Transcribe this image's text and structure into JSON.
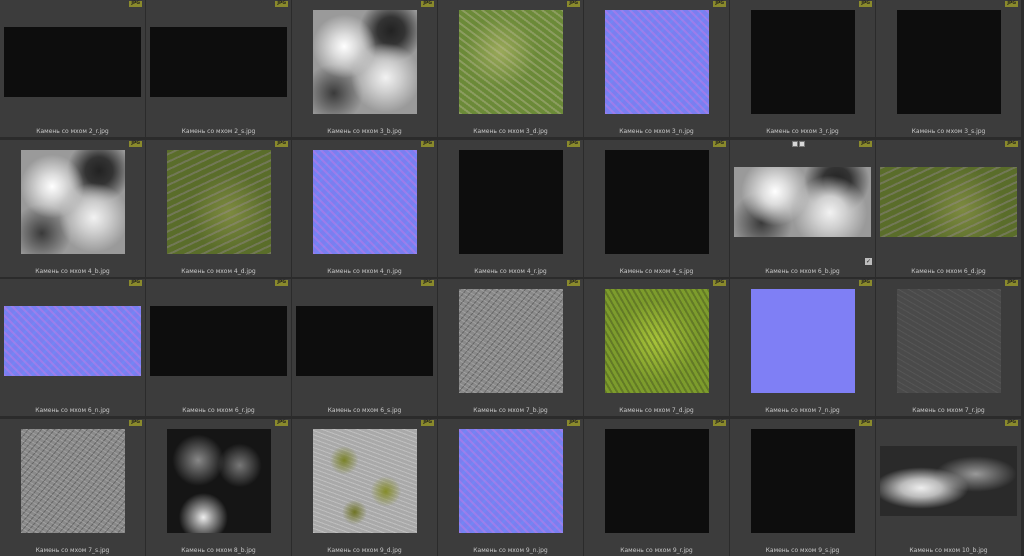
{
  "badge": "JPG",
  "check": "✓",
  "tiles": [
    {
      "label": "Камень со мхом 2_r.jpg",
      "kind": "black",
      "shape": "wide"
    },
    {
      "label": "Камень со мхом 2_s.jpg",
      "kind": "black",
      "shape": "wide"
    },
    {
      "label": "Камень со мхом 3_b.jpg",
      "kind": "clouds",
      "shape": "square"
    },
    {
      "label": "Камень со мхом 3_d.jpg",
      "kind": "grass",
      "shape": "square"
    },
    {
      "label": "Камень со мхом 3_n.jpg",
      "kind": "normal",
      "shape": "square"
    },
    {
      "label": "Камень со мхом 3_r.jpg",
      "kind": "black",
      "shape": "square"
    },
    {
      "label": "Камень со мхом 3_s.jpg",
      "kind": "black",
      "shape": "square"
    },
    {
      "label": "Камень со мхом 4_b.jpg",
      "kind": "clouds",
      "shape": "square"
    },
    {
      "label": "Камень со мхом 4_d.jpg",
      "kind": "grass2",
      "shape": "square"
    },
    {
      "label": "Камень со мхом 4_n.jpg",
      "kind": "normal",
      "shape": "square"
    },
    {
      "label": "Камень со мхом 4_r.jpg",
      "kind": "black",
      "shape": "square"
    },
    {
      "label": "Камень со мхом 4_s.jpg",
      "kind": "black",
      "shape": "square"
    },
    {
      "label": "Камень со мхом 6_b.jpg",
      "kind": "clouds",
      "shape": "wide",
      "selected": true
    },
    {
      "label": "Камень со мхом 6_d.jpg",
      "kind": "grass2",
      "shape": "wide"
    },
    {
      "label": "Камень со мхом 6_n.jpg",
      "kind": "normal",
      "shape": "wide"
    },
    {
      "label": "Камень со мхом 6_r.jpg",
      "kind": "black",
      "shape": "wide"
    },
    {
      "label": "Камень со мхом 6_s.jpg",
      "kind": "black",
      "shape": "wide"
    },
    {
      "label": "Камень со мхом 7_b.jpg",
      "kind": "gray",
      "shape": "square"
    },
    {
      "label": "Камень со мхом 7_d.jpg",
      "kind": "moss",
      "shape": "square"
    },
    {
      "label": "Камень со мхом 7_n.jpg",
      "kind": "flatnormal",
      "shape": "square"
    },
    {
      "label": "Камень со мхом 7_r.jpg",
      "kind": "darkgray",
      "shape": "square"
    },
    {
      "label": "Камень со мхом 7_s.jpg",
      "kind": "gray",
      "shape": "square"
    },
    {
      "label": "Камень со мхом 8_b.jpg",
      "kind": "darkclouds",
      "shape": "square"
    },
    {
      "label": "Камень со мхом 9_d.jpg",
      "kind": "stonemoss",
      "shape": "square"
    },
    {
      "label": "Камень со мхом 9_n.jpg",
      "kind": "normal",
      "shape": "square"
    },
    {
      "label": "Камень со мхом 9_r.jpg",
      "kind": "black",
      "shape": "square"
    },
    {
      "label": "Камень со мхом 9_s.jpg",
      "kind": "black",
      "shape": "square"
    },
    {
      "label": "Камень со мхом 10_b.jpg",
      "kind": "clouds2",
      "shape": "wide"
    }
  ]
}
